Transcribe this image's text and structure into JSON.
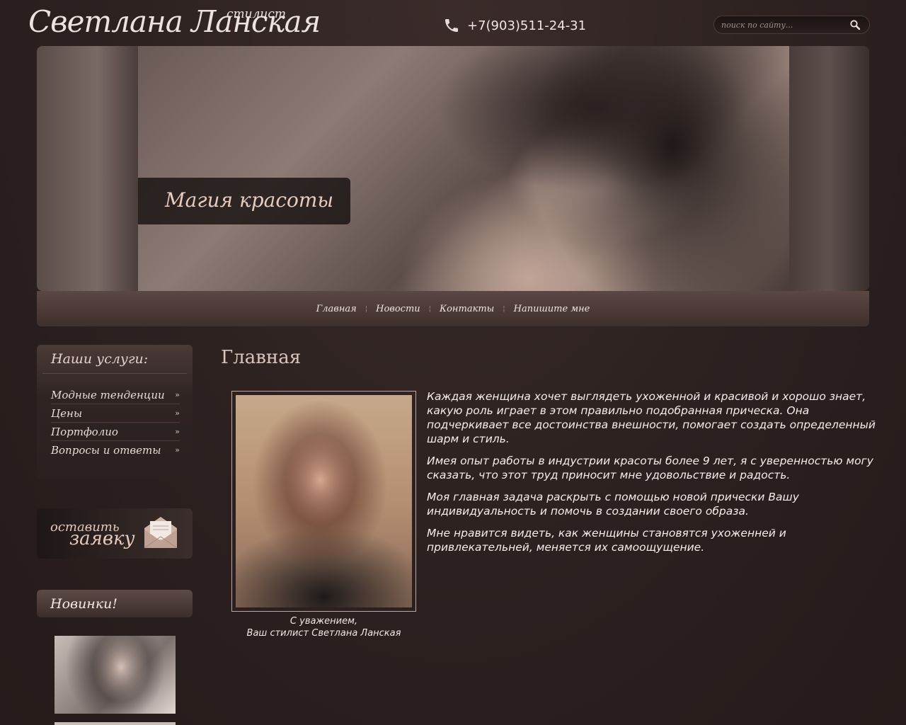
{
  "header": {
    "logo_main": "Светлана Ланская",
    "logo_sub": "стилист",
    "phone": "+7(903)511-24-31",
    "search_placeholder": "поиск по сайту..."
  },
  "banner": {
    "caption": "Магия красоты"
  },
  "nav": {
    "items": [
      "Главная",
      "Новости",
      "Контакты",
      "Напишите мне"
    ]
  },
  "sidebar": {
    "services_title": "Наши услуги:",
    "services": [
      "Модные тенденции",
      "Цены",
      "Портфолио",
      "Вопросы и ответы"
    ],
    "arrow": "»",
    "order_line1": "оставить",
    "order_line2": "заявку",
    "new_title": "Новинки!"
  },
  "main": {
    "title": "Главная",
    "signature_line1": "С уважением,",
    "signature_line2": "Ваш стилист Светлана Ланская",
    "paragraphs": [
      "Каждая женщина хочет выглядеть ухоженной и красивой и хорошо знает, какую роль играет в этом правильно подобранная прическа. Она подчеркивает все достоинства внешности, помогает создать определенный шарм и стиль.",
      "Имея опыт работы в индустрии красоты более 9 лет, я с уверенностью могу сказать, что этот труд  приносит  мне удовольствие и радость.",
      "Моя главная задача раскрыть с помощью новой прически Вашу индивидуальность и помочь в  создании своего образа.",
      "Мне нравится видеть, как женщины становятся ухоженней и привлекательней, меняется их самоощущение."
    ]
  }
}
